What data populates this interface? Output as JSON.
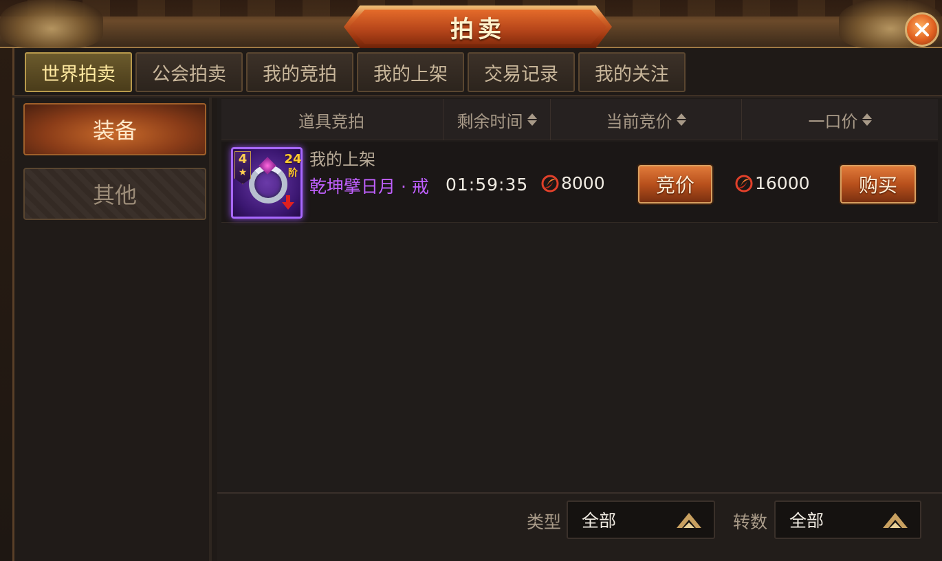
{
  "window": {
    "title": "拍卖"
  },
  "tabs": [
    {
      "label": "世界拍卖",
      "active": true
    },
    {
      "label": "公会拍卖",
      "active": false
    },
    {
      "label": "我的竞拍",
      "active": false
    },
    {
      "label": "我的上架",
      "active": false
    },
    {
      "label": "交易记录",
      "active": false
    },
    {
      "label": "我的关注",
      "active": false
    }
  ],
  "categories": [
    {
      "label": "装备",
      "active": true
    },
    {
      "label": "其他",
      "active": false
    }
  ],
  "table": {
    "headers": {
      "item": "道具竞拍",
      "time_left": "剩余时间",
      "current_bid": "当前竞价",
      "buyout": "一口价"
    },
    "rows": [
      {
        "seller": "我的上架",
        "item_name": "乾坤擘日月 · 戒",
        "star_level": "4",
        "stage": "24",
        "stage_unit": "阶",
        "time_left": "01:59:35",
        "current_bid": "8000",
        "buyout": "16000",
        "bid_label": "竞价",
        "buy_label": "购买"
      }
    ]
  },
  "filters": {
    "type_label": "类型",
    "type_value": "全部",
    "rebirth_label": "转数",
    "rebirth_value": "全部"
  },
  "colors": {
    "accent": "#d6672a",
    "item_quality_purple": "#c060ff",
    "gold": "#ffd050"
  },
  "icons": {
    "close": "close-icon",
    "sort": "sort-icon",
    "coin": "currency-icon",
    "dropdown": "chevron-up-icon",
    "downgrade": "down-arrow-icon"
  }
}
